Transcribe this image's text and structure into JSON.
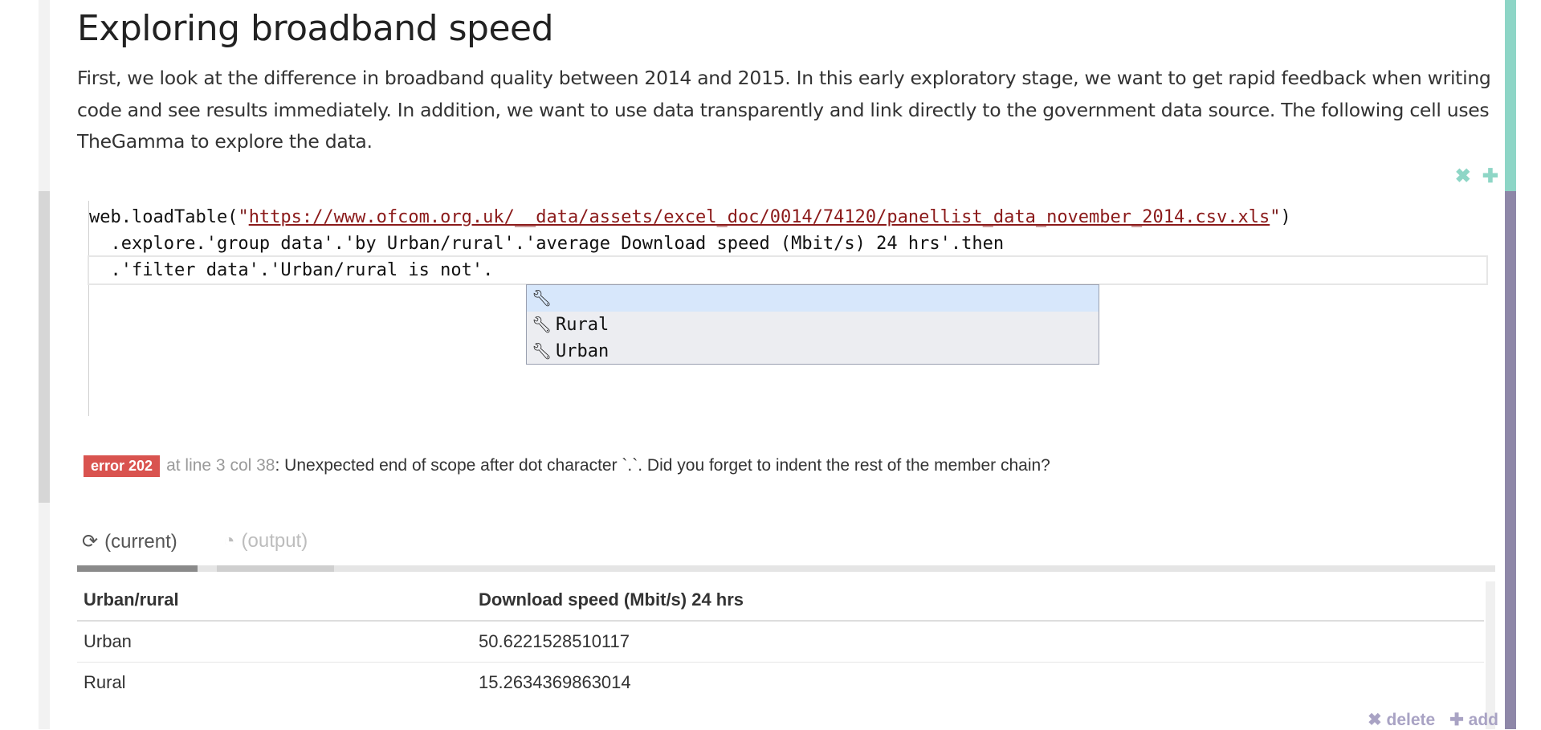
{
  "heading": "Exploring broadband speed",
  "intro": "First, we look at the difference in broadband quality between 2014 and 2015. In this early exploratory stage, we want to get rapid feedback when writing code and see results immediately. In addition, we want to use data transparently and link directly to the government data source. The following cell uses TheGamma to explore the data.",
  "cell_actions": {
    "remove_icon": "✖",
    "add_icon": "✚"
  },
  "code": {
    "line1_prefix": "web.loadTable(",
    "line1_quote_open": "\"",
    "line1_url": "https://www.ofcom.org.uk/__data/assets/excel_doc/0014/74120/panellist_data_november_2014.csv.xls",
    "line1_quote_close": "\"",
    "line1_suffix": ")",
    "line2": "  .explore.'group data'.'by Urban/rural'.'average Download speed (Mbit/s) 24 hrs'.then",
    "line3": "  .'filter data'.'Urban/rural is not'."
  },
  "autocomplete": {
    "items": [
      {
        "icon": "wrench-icon",
        "label": ""
      },
      {
        "icon": "wrench-icon",
        "label": "Rural"
      },
      {
        "icon": "wrench-icon",
        "label": "Urban"
      }
    ]
  },
  "error": {
    "badge": "error 202",
    "location": "at line 3 col 38",
    "message": ": Unexpected end of scope after dot character `.`. Did you forget to indent the rest of the member chain?"
  },
  "tabs": [
    {
      "icon": "refresh-icon",
      "label": "(current)"
    },
    {
      "icon": "pie-chart-icon",
      "label": "(output)"
    }
  ],
  "table": {
    "headers": [
      "Urban/rural",
      "Download speed (Mbit/s) 24 hrs"
    ],
    "rows": [
      [
        "Urban",
        "50.6221528510117"
      ],
      [
        "Rural",
        "15.2634369863014"
      ]
    ]
  },
  "footer": {
    "delete_label": "✖ delete",
    "add_label": "✚ add"
  },
  "colors": {
    "accent_teal": "#8dd5c6",
    "accent_purple": "#8e87a8",
    "error_red": "#d9534f",
    "code_string": "#8b1a1a"
  }
}
